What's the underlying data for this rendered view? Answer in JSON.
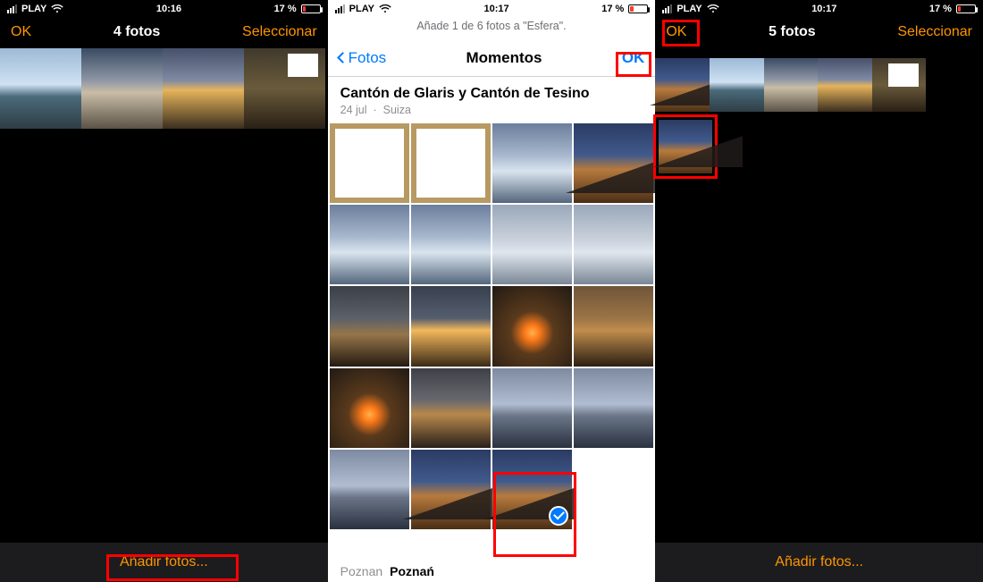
{
  "screen1": {
    "status": {
      "carrier": "PLAY",
      "time": "10:16",
      "battery": "17 %"
    },
    "nav": {
      "ok": "OK",
      "title": "4 fotos",
      "select": "Seleccionar"
    },
    "bottom": "Añadir fotos..."
  },
  "screen2": {
    "status": {
      "carrier": "PLAY",
      "time": "10:17",
      "battery": "17 %"
    },
    "instruction": "Añade 1 de 6 fotos a \"Esfera\".",
    "nav": {
      "back": "Fotos",
      "title": "Momentos",
      "ok": "OK"
    },
    "album": {
      "title": "Cantón de Glaris y Cantón de Tesino",
      "date": "24 jul",
      "sep": "·",
      "country": "Suiza"
    },
    "places": {
      "a": "Poznan",
      "b": "Poznań"
    }
  },
  "screen3": {
    "status": {
      "carrier": "PLAY",
      "time": "10:17",
      "battery": "17 %"
    },
    "nav": {
      "ok": "OK",
      "title": "5 fotos",
      "select": "Seleccionar"
    },
    "bottom": "Añadir fotos..."
  }
}
